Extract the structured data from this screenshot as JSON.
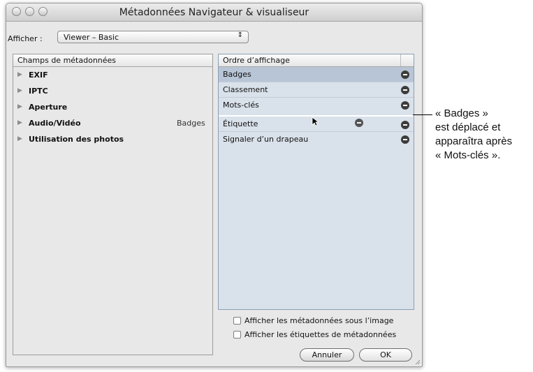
{
  "window": {
    "title": "Métadonnées Navigateur & visualiseur"
  },
  "view_selector": {
    "label": "Afficher :",
    "value": "Viewer – Basic"
  },
  "left_panel": {
    "header": "Champs de métadonnées",
    "items": [
      {
        "label": "EXIF"
      },
      {
        "label": "IPTC"
      },
      {
        "label": "Aperture"
      },
      {
        "label": "Audio/Vidéo"
      },
      {
        "label": "Utilisation des photos"
      }
    ],
    "drag_ghost": "Badges"
  },
  "right_panel": {
    "header": "Ordre d’affichage",
    "items": [
      {
        "label": "Badges",
        "selected": true
      },
      {
        "label": "Classement",
        "selected": false
      },
      {
        "label": "Mots-clés",
        "selected": false
      },
      {
        "label": "Étiquette",
        "selected": false
      },
      {
        "label": "Signaler d’un drapeau",
        "selected": false
      }
    ]
  },
  "options": {
    "show_below_image": "Afficher les métadonnées sous l’image",
    "show_labels": "Afficher les étiquettes de métadonnées"
  },
  "buttons": {
    "cancel": "Annuler",
    "ok": "OK"
  },
  "annotation": {
    "lines": [
      "« Badges »",
      "est déplacé et",
      "apparaîtra après",
      "« Mots-clés »."
    ]
  }
}
